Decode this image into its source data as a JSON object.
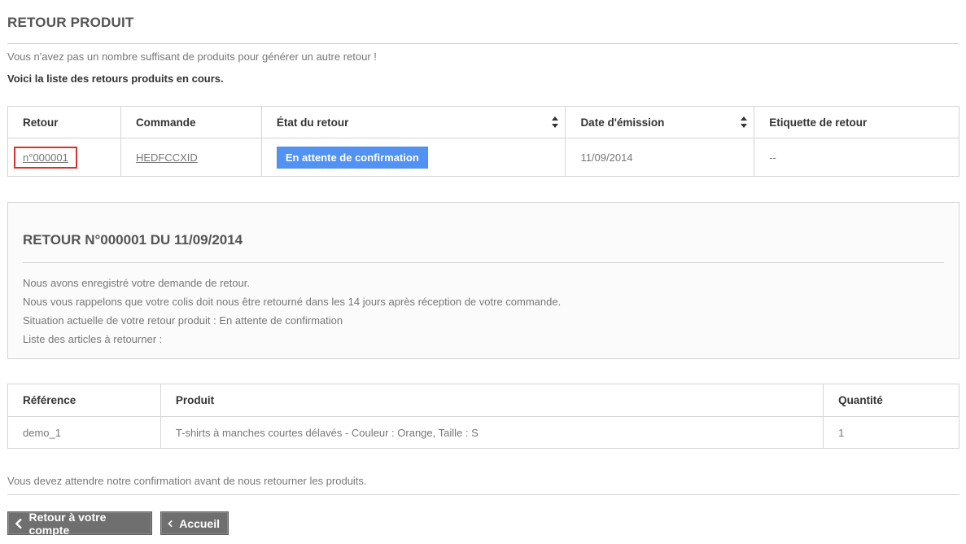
{
  "page": {
    "heading": "RETOUR PRODUIT",
    "notice": "Vous n'avez pas un nombre suffisant de produits pour générer un autre retour !",
    "list_intro": "Voici la liste des retours produits en cours."
  },
  "returns_table": {
    "headers": {
      "retour": "Retour",
      "commande": "Commande",
      "etat": "État du retour",
      "date": "Date d'émission",
      "etiquette": "Etiquette de retour"
    },
    "rows": [
      {
        "retour": "n°000001",
        "commande": "HEDFCCXID",
        "etat": "En attente de confirmation",
        "date": "11/09/2014",
        "etiquette": "--"
      }
    ],
    "status_color": "#5192f3",
    "highlight_color": "#d9322e"
  },
  "detail": {
    "title": "RETOUR N°000001 DU 11/09/2014",
    "lines": [
      "Nous avons enregistré votre demande de retour.",
      "Nous vous rappelons que votre colis doit nous être retourné dans les 14 jours après réception de votre commande.",
      "Situation actuelle de votre retour produit : En attente de confirmation",
      "Liste des articles à retourner :"
    ]
  },
  "items_table": {
    "headers": {
      "reference": "Référence",
      "produit": "Produit",
      "quantite": "Quantité"
    },
    "rows": [
      {
        "reference": "demo_1",
        "produit": "T-shirts à manches courtes délavés - Couleur : Orange, Taille : S",
        "quantite": "1"
      }
    ]
  },
  "footer": {
    "note": "Vous devez attendre notre confirmation avant de nous retourner les produits.",
    "back_button": "Retour à votre compte",
    "home_button": "Accueil",
    "button_icon": "chevron-left-icon"
  }
}
